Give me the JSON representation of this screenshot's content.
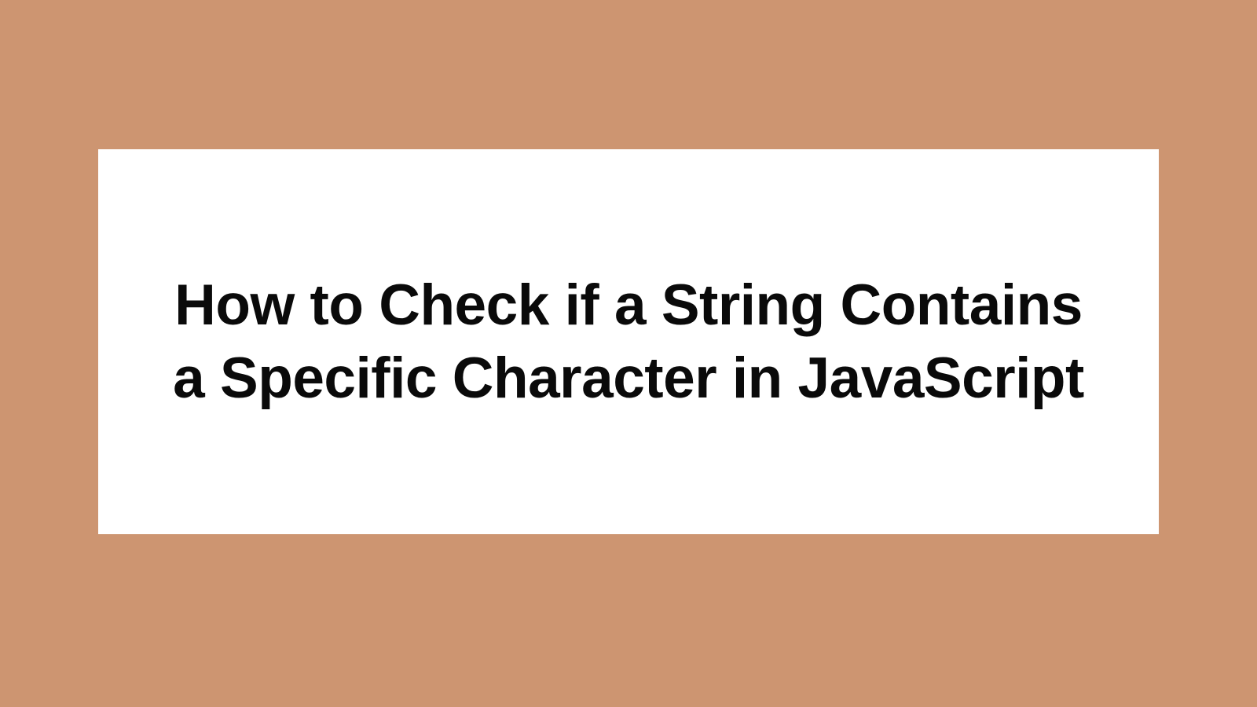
{
  "heading": {
    "text": "How to Check if a String Contains a Specific Character in JavaScript"
  }
}
